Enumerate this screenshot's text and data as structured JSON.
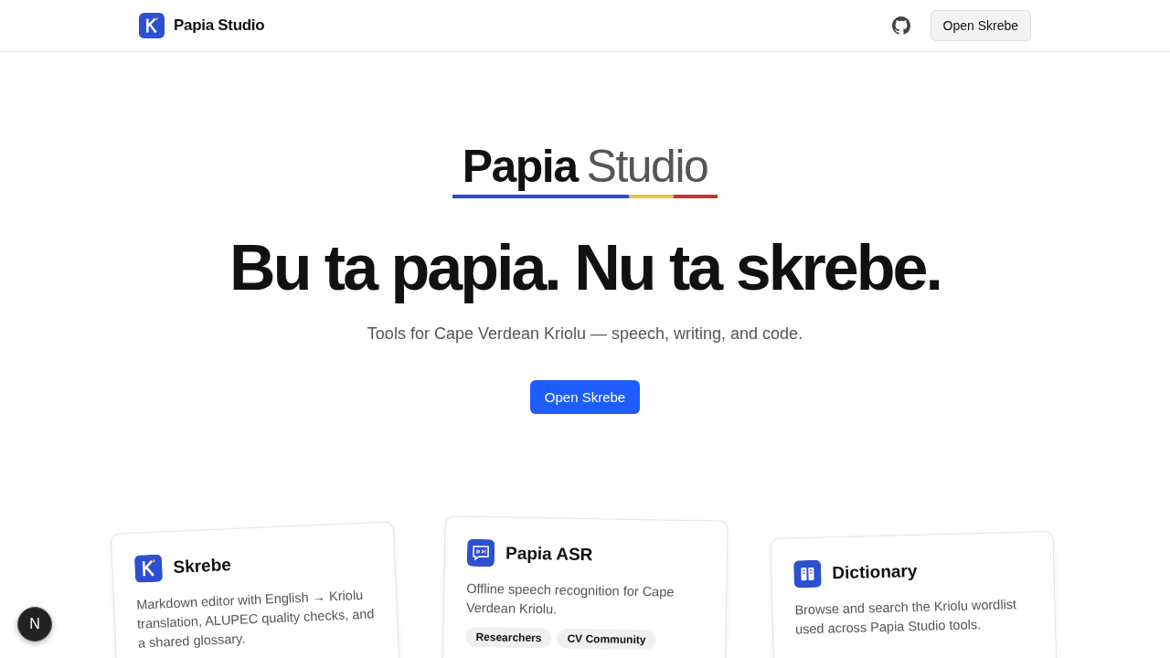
{
  "header": {
    "brand": "Papia Studio",
    "button": "Open Skrebe"
  },
  "hero": {
    "logo_bold": "Papia",
    "logo_light": "Studio",
    "headline": "Bu ta papia. Nu ta skrebe.",
    "subtitle": "Tools for Cape Verdean Kriolu — speech, writing, and code.",
    "button": "Open Skrebe"
  },
  "cards": [
    {
      "kind": "editor",
      "title": "Skrebe",
      "description": "Markdown editor with English → Kriolu translation, ALUPEC quality checks, and a shared glossary."
    },
    {
      "kind": "speech",
      "title": "Papia ASR",
      "description": "Offline speech recognition for Cape Verdean Kriolu.",
      "tags": [
        "Researchers",
        "CV Community"
      ]
    },
    {
      "kind": "book",
      "title": "Dictionary",
      "description": "Browse and search the Kriolu wordlist used across Papia Studio tools."
    }
  ],
  "fab": {
    "label": "N"
  }
}
